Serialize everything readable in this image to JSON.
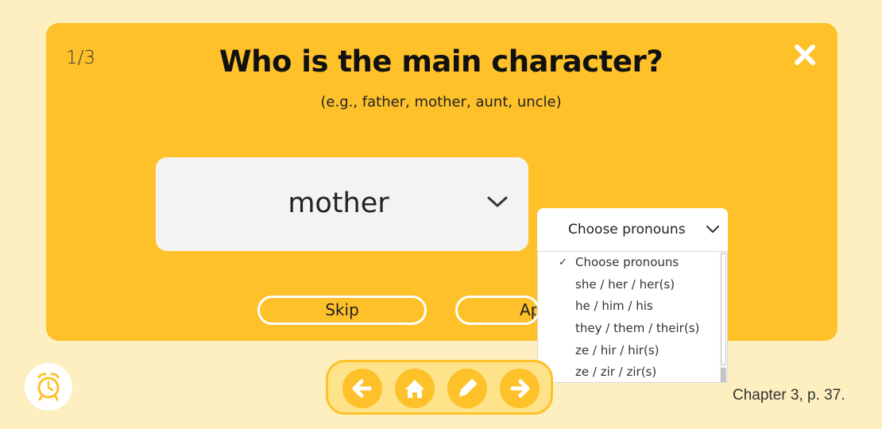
{
  "question": {
    "counter": "1/3",
    "title": "Who is the main character?",
    "hint": "(e.g., father, mother, aunt, uncle)"
  },
  "answer_select": {
    "value": "mother",
    "icon": "chevron-down-icon"
  },
  "pronoun_select": {
    "value": "Choose pronouns",
    "icon": "chevron-down-icon",
    "options": [
      {
        "label": "Choose pronouns",
        "checked": true
      },
      {
        "label": "she / her / her(s)"
      },
      {
        "label": "he / him / his"
      },
      {
        "label": "they / them / their(s)"
      },
      {
        "label": "ze / hir / hir(s)"
      },
      {
        "label": "ze / zir / zir(s)"
      }
    ]
  },
  "actions": {
    "skip_label": "Skip",
    "apply_label": "Ap"
  },
  "nav": [
    {
      "icon": "arrow-left-icon"
    },
    {
      "icon": "home-icon"
    },
    {
      "icon": "pencil-icon"
    },
    {
      "icon": "arrow-right-icon"
    }
  ],
  "alarm_icon": "alarm-clock-icon",
  "close_icon": "close-icon",
  "page_ref": "Chapter 3, p. 37.",
  "colors": {
    "background": "#fdefc0",
    "panel": "#fec12a",
    "navbar": "#fee38b",
    "white": "#ffffff"
  }
}
